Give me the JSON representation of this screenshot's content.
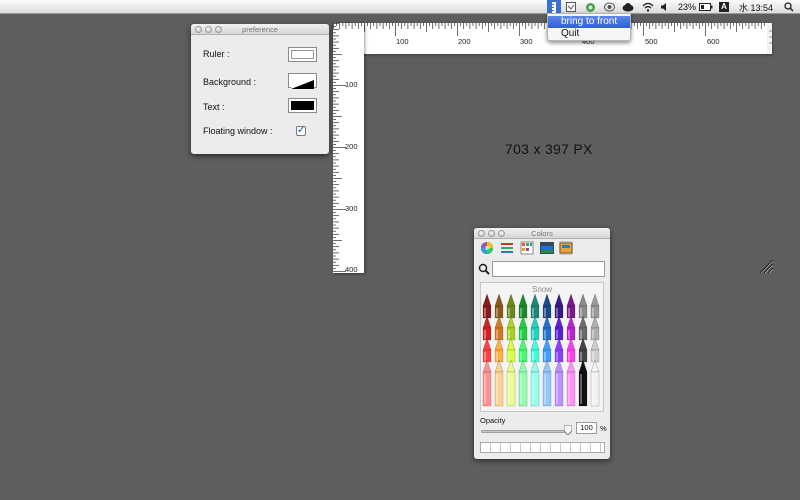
{
  "menubar": {
    "battery": "23%",
    "input_mode": "A",
    "clock": "水 13:54"
  },
  "app_menu": {
    "items": [
      "bring to front",
      "Quit"
    ]
  },
  "ruler": {
    "h_labels": [
      "100",
      "200",
      "300",
      "400",
      "500",
      "600"
    ],
    "v_labels": [
      "100",
      "200",
      "300",
      "400"
    ]
  },
  "size_readout": "703 x 397 PX",
  "preference": {
    "title": "preference",
    "ruler_label": "Ruler :",
    "background_label": "Background :",
    "text_label": "Text :",
    "floating_label": "Floating window :",
    "floating_checked": true
  },
  "colors_panel": {
    "title": "Colors",
    "crayon_name": "Snow",
    "opacity_label": "Opacity",
    "opacity_value": "100",
    "percent": "%"
  }
}
